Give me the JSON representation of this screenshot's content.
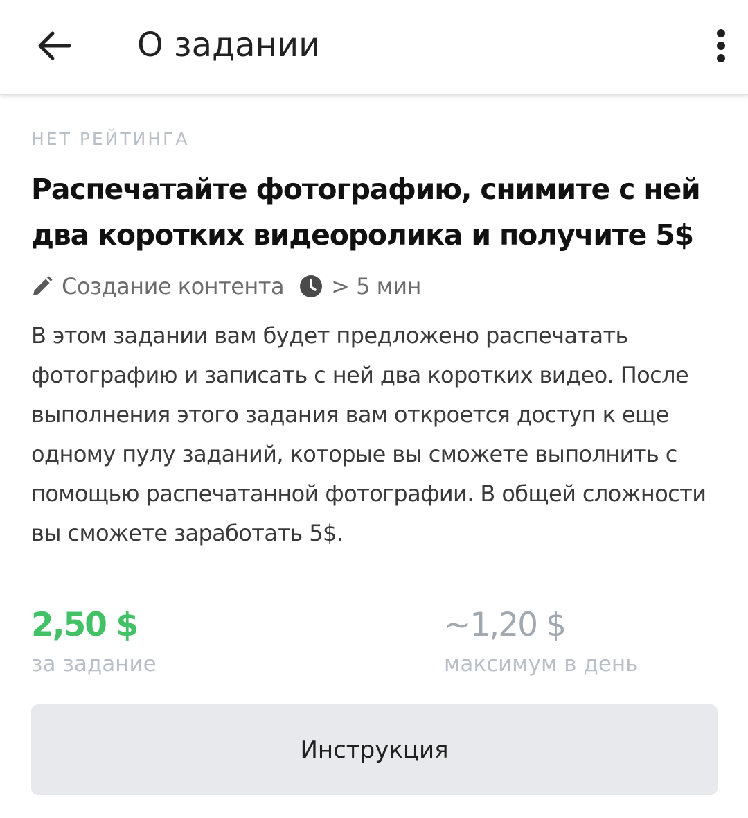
{
  "header": {
    "title": "О задании",
    "back_icon": "arrow-left-icon",
    "menu_icon": "more-vertical-icon"
  },
  "task": {
    "rating_label": "НЕТ РЕЙТИНГА",
    "title": "Распечатайте фотографию, снимите с ней два коротких видеоролика и получите 5$",
    "category_icon": "pencil-icon",
    "category": "Создание контента",
    "duration_icon": "clock-icon",
    "duration": "> 5 мин",
    "description": "В этом задании вам будет предложено распечатать фотографию и записать с ней два коротких видео. После выполнения этого задания вам откроется доступ к еще одному пулу заданий, которые вы сможете выполнить с помощью распечатанной фотографии. В общей сложности вы сможете заработать 5$."
  },
  "pricing": {
    "per_task_value": "2,50 $",
    "per_task_label": "за задание",
    "max_daily_value": "~1,20 $",
    "max_daily_label": "максимум в день"
  },
  "actions": {
    "instruction_label": "Инструкция"
  },
  "colors": {
    "accent_green": "#43c167",
    "muted_gray": "#b9bfc6",
    "button_bg": "#e7e9ec"
  }
}
